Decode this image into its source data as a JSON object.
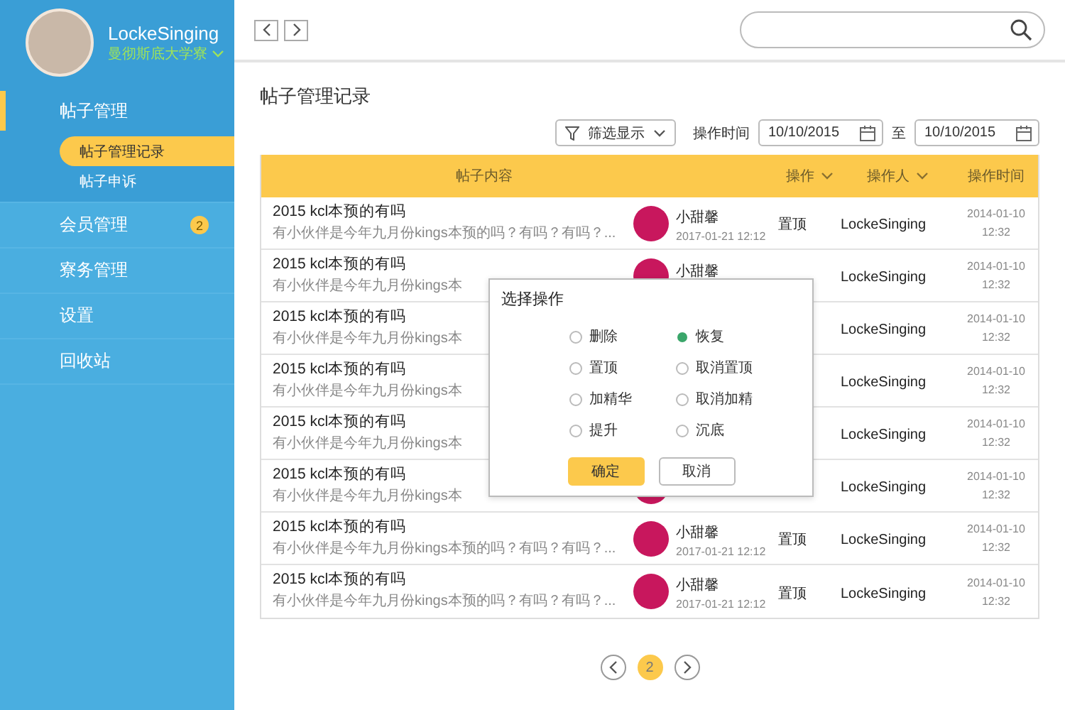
{
  "sidebar": {
    "profile": {
      "name": "LockeSinging",
      "organization": "曼彻斯底大学寮"
    },
    "items": [
      {
        "label": "帖子管理",
        "selected": true,
        "expanded": true,
        "children": [
          {
            "label": "帖子管理记录",
            "selected": true
          },
          {
            "label": "帖子申诉",
            "selected": false
          }
        ]
      },
      {
        "label": "会员管理",
        "selected": false,
        "expanded": false,
        "badge": "2"
      },
      {
        "label": "寮务管理",
        "selected": false,
        "expanded": false
      },
      {
        "label": "设置",
        "selected": false,
        "expanded": false
      },
      {
        "label": "回收站",
        "selected": false,
        "expanded": false
      }
    ]
  },
  "page": {
    "title": "帖子管理记录"
  },
  "filters": {
    "filter_dropdown": "筛选显示",
    "time_label": "操作时间",
    "date_from": "10/10/2015",
    "separator": "至",
    "date_to": "10/10/2015"
  },
  "table": {
    "columns": [
      {
        "label": "帖子内容",
        "sortable": false
      },
      {
        "label": "操作",
        "sortable": true
      },
      {
        "label": "操作人",
        "sortable": true
      },
      {
        "label": "操作时间",
        "sortable": false
      }
    ],
    "rows": [
      {
        "title": "2015 kcl本预的有吗",
        "excerpt": "有小伙伴是今年九月份kings本预的吗？有吗？有吗？...",
        "avatar": true,
        "author": "小甜馨",
        "date": "2017-01-21 12:12",
        "action": "置顶",
        "operator": "LockeSinging",
        "time_date": "2014-01-10",
        "time_clock": "12:32"
      },
      {
        "title": "2015 kcl本预的有吗",
        "excerpt": "有小伙伴是今年九月份kings本",
        "avatar": true,
        "author": "小甜馨",
        "operator": "LockeSinging",
        "time_date": "2014-01-10",
        "time_clock": "12:32"
      },
      {
        "title": "2015 kcl本预的有吗",
        "excerpt": "有小伙伴是今年九月份kings本",
        "operator": "LockeSinging",
        "time_date": "2014-01-10",
        "time_clock": "12:32"
      },
      {
        "title": "2015 kcl本预的有吗",
        "excerpt": "有小伙伴是今年九月份kings本",
        "operator": "LockeSinging",
        "time_date": "2014-01-10",
        "time_clock": "12:32"
      },
      {
        "title": "2015 kcl本预的有吗",
        "excerpt": "有小伙伴是今年九月份kings本",
        "operator": "LockeSinging",
        "time_date": "2014-01-10",
        "time_clock": "12:32"
      },
      {
        "title": "2015 kcl本预的有吗",
        "excerpt": "有小伙伴是今年九月份kings本",
        "avatar": true,
        "operator": "LockeSinging",
        "time_date": "2014-01-10",
        "time_clock": "12:32"
      },
      {
        "title": "2015 kcl本预的有吗",
        "excerpt": "有小伙伴是今年九月份kings本预的吗？有吗？有吗？...",
        "avatar": true,
        "author": "小甜馨",
        "date": "2017-01-21 12:12",
        "action": "置顶",
        "operator": "LockeSinging",
        "time_date": "2014-01-10",
        "time_clock": "12:32"
      },
      {
        "title": "2015 kcl本预的有吗",
        "excerpt": "有小伙伴是今年九月份kings本预的吗？有吗？有吗？...",
        "avatar": true,
        "author": "小甜馨",
        "date": "2017-01-21 12:12",
        "action": "置顶",
        "operator": "LockeSinging",
        "time_date": "2014-01-10",
        "time_clock": "12:32"
      }
    ]
  },
  "modal": {
    "title": "选择操作",
    "options": [
      {
        "label": "删除",
        "selected": false
      },
      {
        "label": "恢复",
        "selected": true
      },
      {
        "label": "置顶",
        "selected": false
      },
      {
        "label": "取消置顶",
        "selected": false
      },
      {
        "label": "加精华",
        "selected": false
      },
      {
        "label": "取消加精",
        "selected": false
      },
      {
        "label": "提升",
        "selected": false
      },
      {
        "label": "沉底",
        "selected": false
      }
    ],
    "buttons": [
      {
        "label": "确定",
        "kind": "primary"
      },
      {
        "label": "取消",
        "kind": "secondary"
      }
    ]
  },
  "pagination": {
    "pages": [
      {
        "label": "2",
        "selected": true
      }
    ]
  }
}
